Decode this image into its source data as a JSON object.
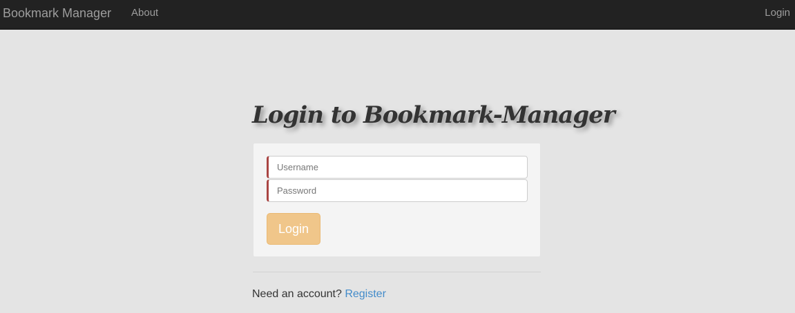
{
  "navbar": {
    "brand": "Bookmark Manager",
    "about": "About",
    "login": "Login"
  },
  "main": {
    "heading": "Login to Bookmark-Manager",
    "username_placeholder": "Username",
    "password_placeholder": "Password",
    "login_button": "Login",
    "footer_prompt": "Need an account?",
    "register_link": "Register"
  },
  "colors": {
    "navbar_bg": "#222222",
    "page_bg": "#e4e4e4",
    "button_bg": "#f0c68a",
    "link": "#428bca",
    "input_error_border": "#a94442"
  }
}
